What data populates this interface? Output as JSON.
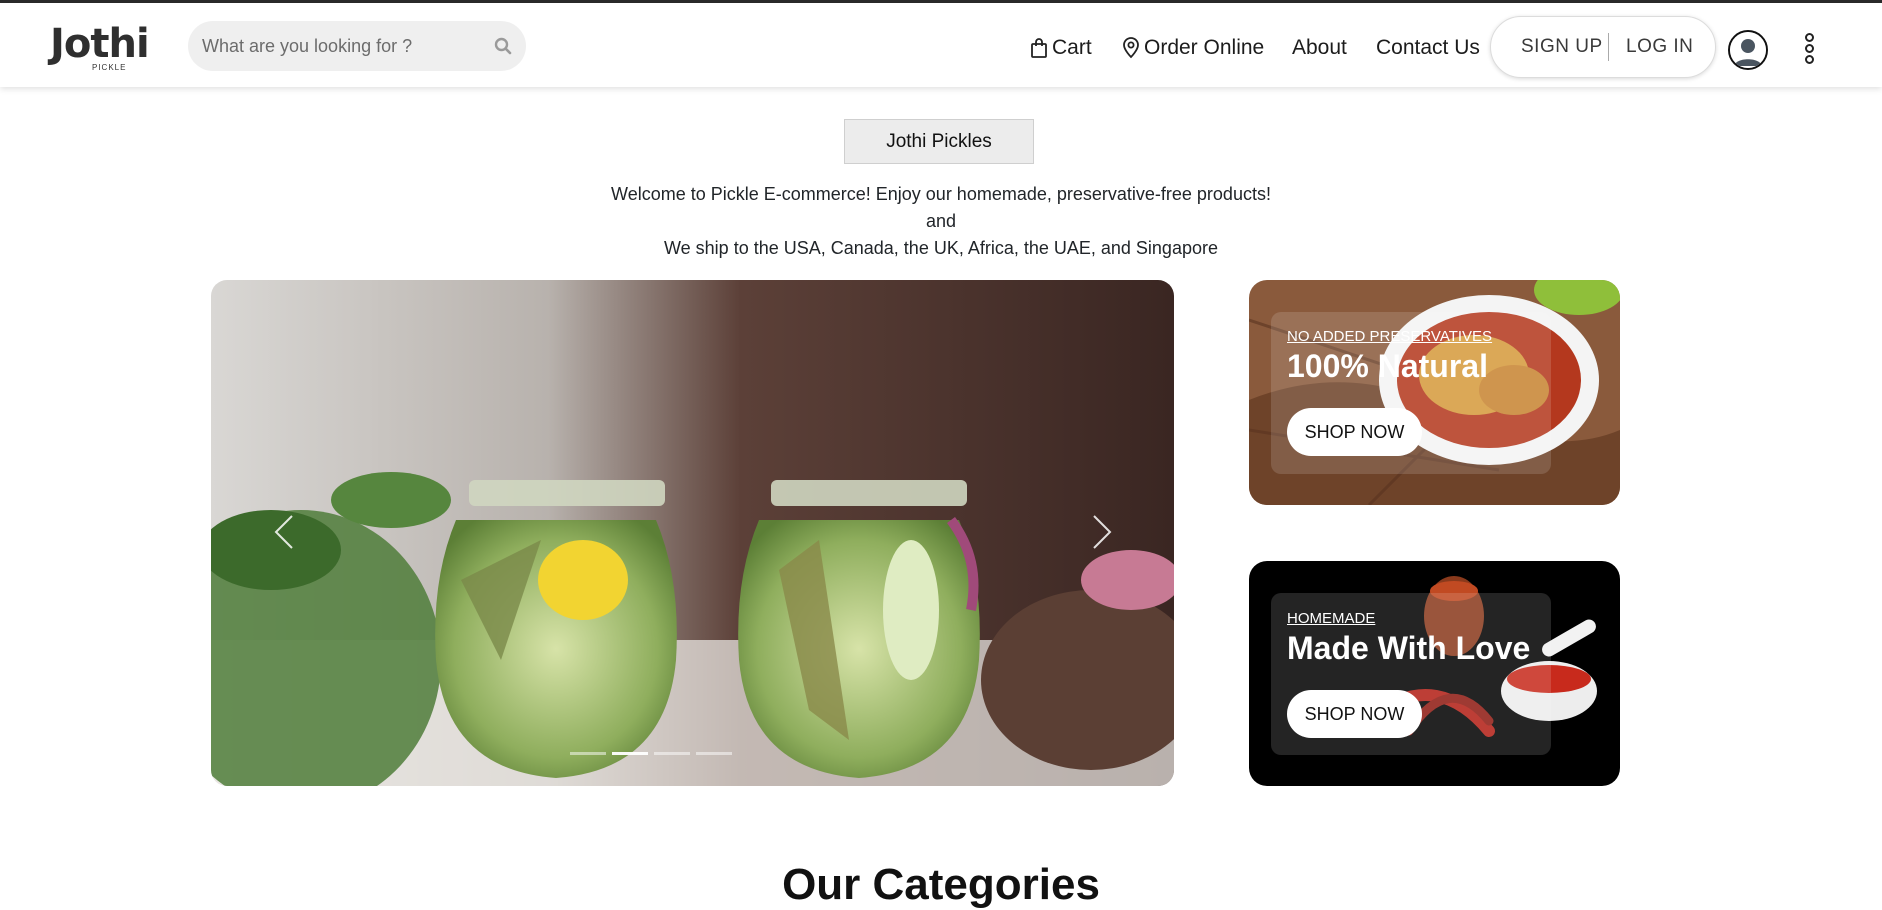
{
  "header": {
    "logo_text": "Jothi",
    "logo_subtext": "PICKLE",
    "search": {
      "placeholder": "What are you looking for ?"
    },
    "nav": {
      "cart": "Cart",
      "order_online": "Order Online",
      "about": "About",
      "contact": "Contact Us"
    },
    "auth": {
      "signup": "SIGN UP",
      "login": "LOG IN"
    }
  },
  "hero": {
    "brand_button": "Jothi Pickles",
    "welcome_line1": "Welcome to Pickle E-commerce! Enjoy our homemade, preservative-free products!",
    "welcome_line2": "and",
    "welcome_line3": "We ship to the USA, Canada, the UK, Africa, the UAE, and Singapore"
  },
  "carousel": {
    "slide_count": 4,
    "active_index": 1
  },
  "promos": [
    {
      "tag": "NO ADDED PRESERVATIVES",
      "title": "100% Natural",
      "button": "SHOP NOW"
    },
    {
      "tag": "HOMEMADE",
      "title": "Made With Love",
      "button": "SHOP NOW"
    }
  ],
  "section": {
    "title": "Our Categories"
  },
  "colors": {
    "accent": "#ffffff",
    "dark_card": "#000000",
    "text": "#212529"
  }
}
